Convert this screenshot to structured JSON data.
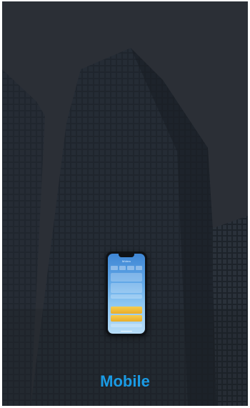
{
  "caption": "Mobile",
  "device_screen": {
    "brand_text": "Midea"
  },
  "colors": {
    "caption": "#1a9be5",
    "sky": "#2b2f36",
    "building": "#1c2128"
  },
  "icons": [
    "city-building-background",
    "smartphone-icon"
  ]
}
